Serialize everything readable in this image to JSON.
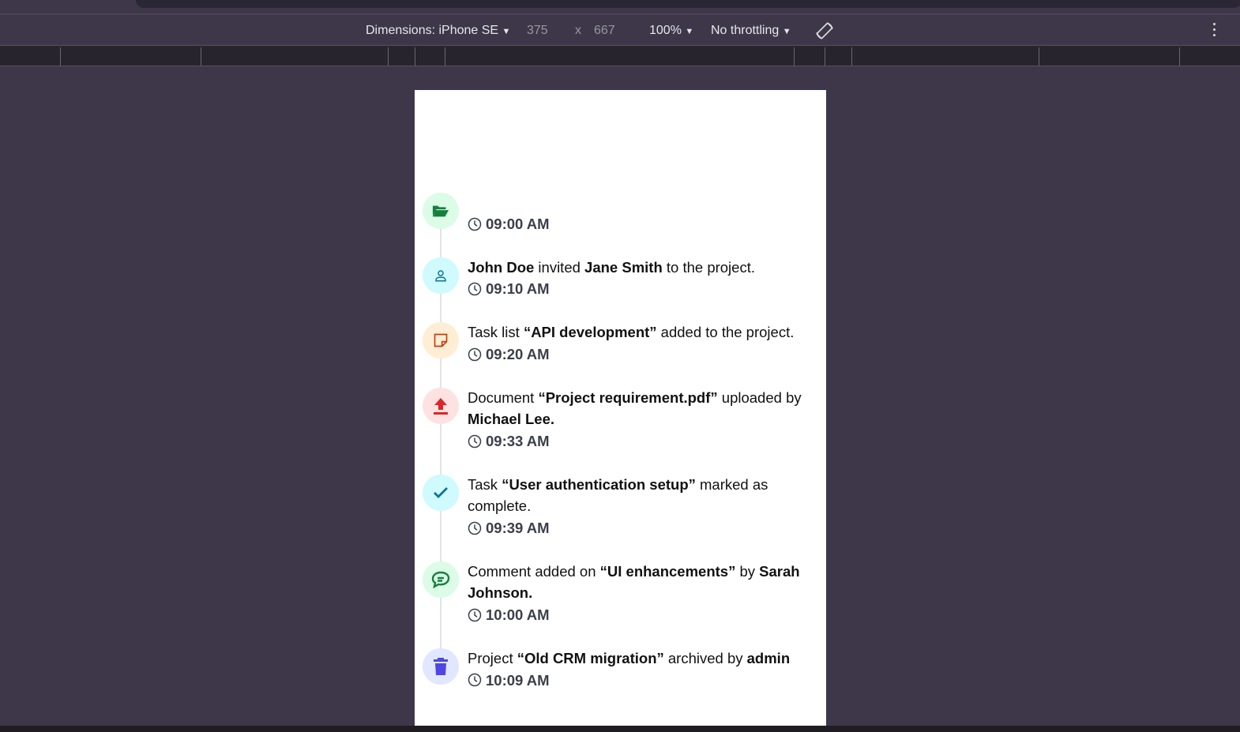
{
  "devtools": {
    "dimensions_label": "Dimensions: iPhone SE",
    "width": "375",
    "times": "x",
    "height": "667",
    "zoom": "100%",
    "throttling": "No throttling"
  },
  "timeline": [
    {
      "icon": "folder-open-icon",
      "bg": "#dcfce7",
      "fg": "#15803d",
      "segments": [],
      "time": "09:00 AM"
    },
    {
      "icon": "user-icon",
      "bg": "#cffafe",
      "fg": "#0e7490",
      "segments": [
        {
          "t": "John Doe",
          "b": true
        },
        {
          "t": " invited "
        },
        {
          "t": "Jane Smith",
          "b": true
        },
        {
          "t": " to the project."
        }
      ],
      "time": "09:10 AM"
    },
    {
      "icon": "sticky-note-icon",
      "bg": "#ffedd5",
      "fg": "#c2410c",
      "segments": [
        {
          "t": "Task list "
        },
        {
          "t": "“API development”",
          "b": true
        },
        {
          "t": " added to the project."
        }
      ],
      "time": "09:20 AM"
    },
    {
      "icon": "upload-icon",
      "bg": "#fee2e2",
      "fg": "#dc2626",
      "segments": [
        {
          "t": "Document "
        },
        {
          "t": "“Project requirement.pdf”",
          "b": true
        },
        {
          "t": " uploaded by "
        },
        {
          "t": "Michael Lee.",
          "b": true
        }
      ],
      "time": "09:33 AM"
    },
    {
      "icon": "check-icon",
      "bg": "#cffafe",
      "fg": "#0e7490",
      "segments": [
        {
          "t": "Task "
        },
        {
          "t": "“User authentication setup”",
          "b": true
        },
        {
          "t": " marked as complete."
        }
      ],
      "time": "09:39 AM"
    },
    {
      "icon": "comment-icon",
      "bg": "#dcfce7",
      "fg": "#15803d",
      "segments": [
        {
          "t": "Comment added on "
        },
        {
          "t": "“UI enhancements”",
          "b": true
        },
        {
          "t": " by "
        },
        {
          "t": "Sarah Johnson.",
          "b": true
        }
      ],
      "time": "10:00 AM"
    },
    {
      "icon": "trash-icon",
      "bg": "#e0e7ff",
      "fg": "#4f46e5",
      "segments": [
        {
          "t": "Project "
        },
        {
          "t": "“Old CRM migration”",
          "b": true
        },
        {
          "t": " archived by "
        },
        {
          "t": "admin",
          "b": true
        }
      ],
      "time": "10:09 AM"
    }
  ]
}
